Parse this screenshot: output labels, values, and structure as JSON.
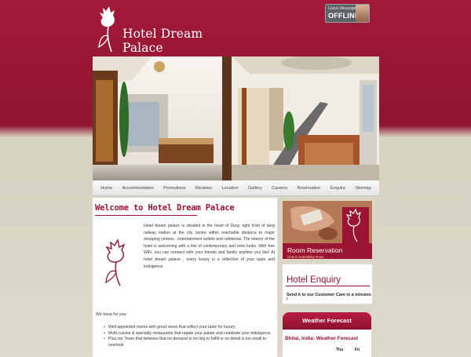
{
  "brand": {
    "name": "Hotel Dream Palace",
    "colors": {
      "primary": "#9b1230",
      "header": "#a3193a",
      "background": "#ddd9cb"
    }
  },
  "chat": {
    "caption": "Leave Messages",
    "status": "OFFLINE"
  },
  "nav": [
    "Home",
    "Accommodation",
    "Promotions",
    "Reviews",
    "Location",
    "Gallery",
    "Careers",
    "Reservation",
    "Enquiry",
    "Sitemap"
  ],
  "content": {
    "welcome_title": "Welcome to Hotel Dream Palace",
    "description": "Hotel dream palace is situated in the heart of Durg, right front of durg railway station at the city centre within reachable distance to major shopping centres , entertainment outlets and cafeterias. The interior of the hotel is welcoming with a mix of contemporary and retro looks. With free WiFi, you can connect with your friends and family anytime you like! At hotel dream palace , every luxury is a reflection of your taste and indulgence.",
    "we_have_title": "We have for you:",
    "features": [
      "Well appointed rooms with great views that reflect your taste for luxury.",
      "Multi cuisine & specialty restaurants that regale your palate and celebrate your indulgence.",
      "Plus our Team that believes that no demand is too big to fulfill or no detail is too small to overlook"
    ]
  },
  "sidebar": {
    "room": {
      "title": "Room Reservation",
      "subtitle": "Check Availability Now!"
    },
    "enquiry": {
      "title": "Hotel Enquiry",
      "subtitle": "Send it to our Customer Care in a minutes !"
    },
    "weather": {
      "title": "Weather Forecast",
      "location": "Bhilai, India: Weather Forecast",
      "days": [
        "Thu",
        "Fri"
      ]
    }
  }
}
